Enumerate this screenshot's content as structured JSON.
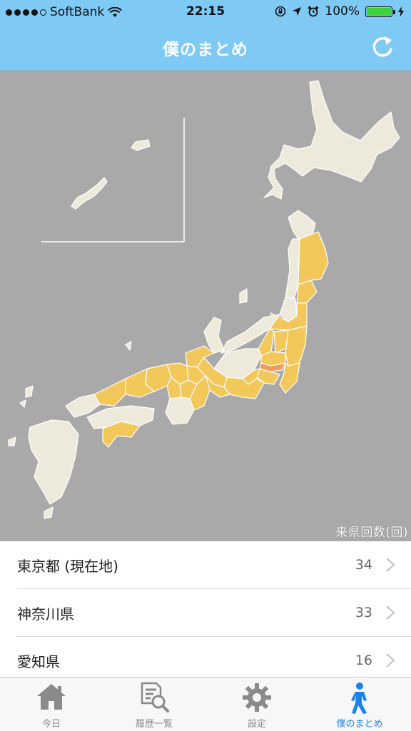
{
  "status": {
    "carrier": "SoftBank",
    "time": "22:15",
    "battery": "100%"
  },
  "nav": {
    "title": "僕のまとめ",
    "refresh_icon": "refresh-icon"
  },
  "map": {
    "caption": "来県回数(回)",
    "colors": {
      "sea": "#a9a9a9",
      "unvisited": "#eeeadb",
      "visited": "#f2c85b",
      "current": "#f39a5c",
      "border": "#ffffff"
    }
  },
  "list": {
    "items": [
      {
        "name": "東京都 (現在地)",
        "count": "34"
      },
      {
        "name": "神奈川県",
        "count": "33"
      },
      {
        "name": "愛知県",
        "count": "16"
      }
    ]
  },
  "tabs": [
    {
      "label": "今日",
      "icon": "home-icon"
    },
    {
      "label": "履歴一覧",
      "icon": "history-search-icon"
    },
    {
      "label": "設定",
      "icon": "gear-icon"
    },
    {
      "label": "僕のまとめ",
      "icon": "walking-person-icon",
      "active": true
    }
  ],
  "colors": {
    "accent": "#7fc9f5",
    "active_tab": "#1b82e8"
  }
}
